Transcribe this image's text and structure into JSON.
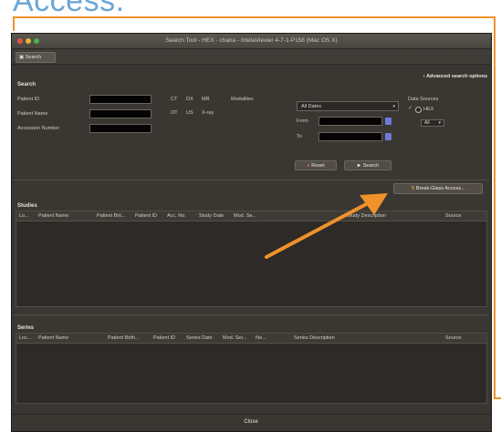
{
  "caption": "Access.",
  "window": {
    "title": "Search Tool - HEX - chana - IntelaViewer 4-7-1-P158 (Mac OS X)"
  },
  "toolbar": {
    "search_tab": "Search"
  },
  "search": {
    "section_title": "Search",
    "advanced_link": "Advanced search options",
    "patient_id_label": "Patient ID",
    "patient_name_label": "Patient Name",
    "accession_label": "Accession Number",
    "modalities_label": "Modalities",
    "modalities_row1": [
      "CT",
      "DX",
      "MR"
    ],
    "modalities_row2": [
      "OT",
      "US",
      "X-ray"
    ],
    "dates_select": "All Dates",
    "from_label": "From",
    "to_label": "To",
    "reset_label": "Reset",
    "search_label": "Search"
  },
  "data_sources": {
    "title": "Data Sources",
    "option1": "HEX",
    "option2": "All"
  },
  "break_glass": {
    "label": "Break-Glass Access..."
  },
  "studies": {
    "title": "Studies",
    "columns": [
      "Lo...",
      "Patient Name",
      "Patient Birt...",
      "Patient ID",
      "Acc. No.",
      "Study Date",
      "Mod. Se...",
      "Study Description",
      "Source"
    ]
  },
  "series": {
    "title": "Series",
    "columns": [
      "Loc...",
      "Patient Name",
      "Patient Birth...",
      "Patient ID",
      "Series Date",
      "Mod. Ser...",
      "No...",
      "Series Description",
      "Source"
    ]
  },
  "footer": {
    "close_label": "Close"
  },
  "colors": {
    "annotation_orange": "#f0922b",
    "caption_blue": "#6aa6d8",
    "window_bg": "#3a3632"
  }
}
